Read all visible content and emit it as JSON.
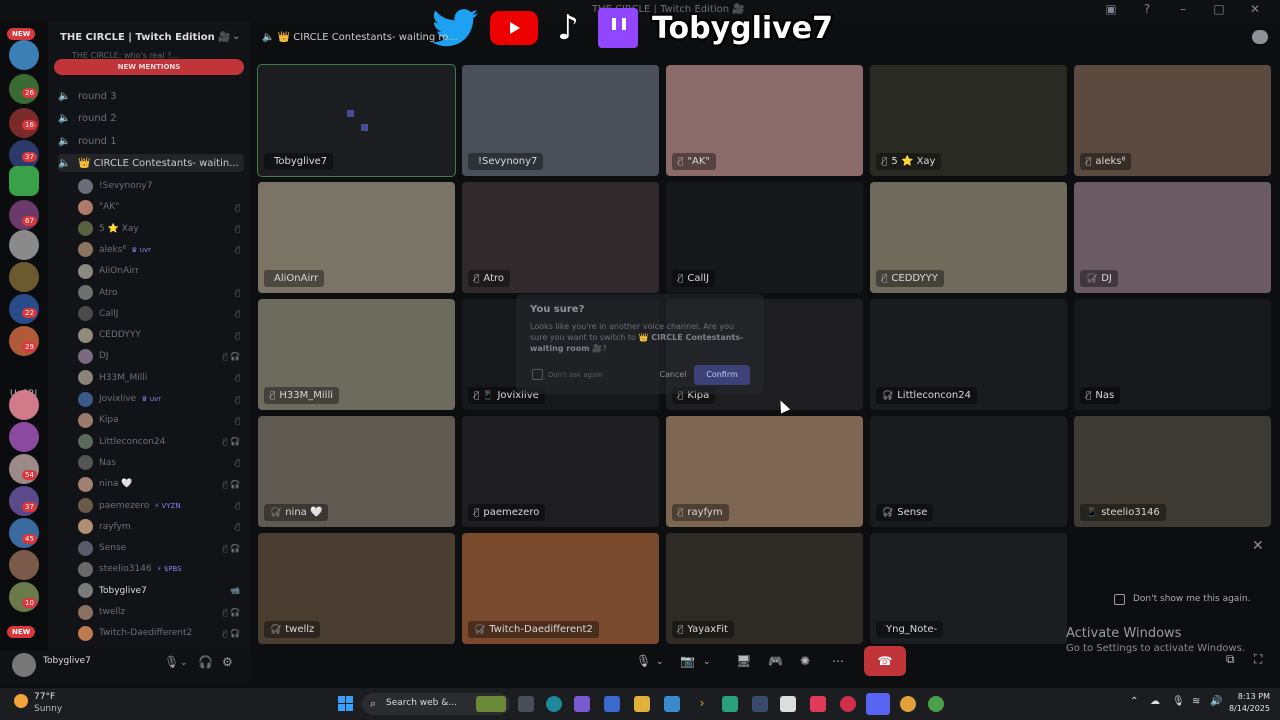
{
  "window": {
    "title": "THE CIRCLE | Twitch Edition 🎥"
  },
  "overlay": {
    "name": "Tobyglive7"
  },
  "rail": {
    "badges": [
      "26",
      "16",
      "37",
      "67",
      "22",
      "29",
      "54",
      "37",
      "45",
      "10"
    ],
    "new_label": "NEW",
    "folder_label": "UsGRI"
  },
  "sidebar": {
    "server_name": "THE CIRCLE | Twitch Edition 🎥",
    "cut_text": "THE CIRCLE: who's real ?...",
    "new_mentions": "NEW MENTIONS",
    "channels": [
      "round 3",
      "round 2",
      "round 1"
    ],
    "active_channel": "👑 CIRCLE Contestants- waitin...",
    "members": [
      {
        "name": "!Sevynony7",
        "tag": "",
        "icons": "",
        "color": "#6b6e78"
      },
      {
        "name": "\"AK\"",
        "tag": "",
        "icons": "🎙̸",
        "color": "#b07a6a"
      },
      {
        "name": "5 ⭐ Xay",
        "tag": "",
        "icons": "🎙̸",
        "color": "#5a6040"
      },
      {
        "name": "aleks⁸",
        "tag": "♛ uvr",
        "icons": "🎙̸",
        "color": "#8d7460"
      },
      {
        "name": "AliOnAirr",
        "tag": "",
        "icons": "",
        "color": "#8a8a80"
      },
      {
        "name": "Atro",
        "tag": "",
        "icons": "🎙̸",
        "color": "#707070"
      },
      {
        "name": "CallJ",
        "tag": "",
        "icons": "🎙̸",
        "color": "#4a4a4a"
      },
      {
        "name": "CEDDYYY",
        "tag": "",
        "icons": "🎙̸",
        "color": "#908a7a"
      },
      {
        "name": "DJ",
        "tag": "",
        "icons": "🎙̸ 🎧̸",
        "color": "#7a6a80"
      },
      {
        "name": "H33M_Milli",
        "tag": "",
        "icons": "🎙̸",
        "color": "#8a8578"
      },
      {
        "name": "Jovixlive",
        "tag": "♛ uvr",
        "icons": "🎙̸",
        "color": "#3a5a8a"
      },
      {
        "name": "Kipa",
        "tag": "",
        "icons": "🎙̸",
        "color": "#9a7a6a"
      },
      {
        "name": "Littleconcon24",
        "tag": "",
        "icons": "🎙̸ 🎧̸",
        "color": "#5a6a5a"
      },
      {
        "name": "Nas",
        "tag": "",
        "icons": "🎙̸",
        "color": "#555555"
      },
      {
        "name": "nina 🤍",
        "tag": "",
        "icons": "🎙̸ 🎧̸",
        "color": "#a08070"
      },
      {
        "name": "paemezero",
        "tag": "⚡ VYZN",
        "icons": "🎙̸",
        "color": "#6a5a4a"
      },
      {
        "name": "rayfym",
        "tag": "",
        "icons": "🎙̸",
        "color": "#b09070"
      },
      {
        "name": "Sense",
        "tag": "",
        "icons": "🎙̸ 🎧̸",
        "color": "#5a5a6a"
      },
      {
        "name": "steelio3146",
        "tag": "⚡ $PBS",
        "icons": "",
        "color": "#6a6a6a"
      },
      {
        "name": "Tobyglive7",
        "tag": "",
        "icons": "📹",
        "color": "#7a7a7a"
      },
      {
        "name": "twellz",
        "tag": "",
        "icons": "🎙̸ 🎧̸",
        "color": "#8a7060"
      },
      {
        "name": "Twitch-Daedifferent2",
        "tag": "",
        "icons": "🎙̸ 🎧̸",
        "color": "#c07a50"
      }
    ]
  },
  "user_panel": {
    "name": "Tobyglive7"
  },
  "call": {
    "header": "👑 CIRCLE Contestants- waiting ro...",
    "tiles": [
      {
        "label": "Tobyglive7",
        "mute": "",
        "bg": "#1c1d21"
      },
      {
        "label": "!Sevynony7",
        "mute": "",
        "bg": "#4b4f59"
      },
      {
        "label": "\"AK\"",
        "mute": "🎙̸",
        "bg": "#8a6b6a"
      },
      {
        "label": "5 ⭐ Xay",
        "mute": "🎙̸",
        "bg": "#2a2a24"
      },
      {
        "label": "aleks⁸",
        "mute": "🎙̸",
        "bg": "#5a4a40"
      },
      {
        "label": "AliOnAirr",
        "mute": "",
        "bg": "#7a7466"
      },
      {
        "label": "Atro",
        "mute": "🎙̸",
        "bg": "#302a2c"
      },
      {
        "label": "CallJ",
        "mute": "🎙̸",
        "bg": "#161719"
      },
      {
        "label": "CEDDYYY",
        "mute": "🎙̸",
        "bg": "#6e6a5c"
      },
      {
        "label": "DJ",
        "mute": "🎧̸",
        "bg": "#6a5a64"
      },
      {
        "label": "H33M_Milli",
        "mute": "🎙̸",
        "bg": "#6d6a5e"
      },
      {
        "label": "Jovixlive",
        "mute": "🎙̸ 📱",
        "bg": "#17181b"
      },
      {
        "label": "Kipa",
        "mute": "🎙̸",
        "bg": "#1e1e20"
      },
      {
        "label": "Littleconcon24",
        "mute": "🎧̸",
        "bg": "#1a1b1d"
      },
      {
        "label": "Nas",
        "mute": "🎙̸",
        "bg": "#17181a"
      },
      {
        "label": "nina 🤍",
        "mute": "🎧̸",
        "bg": "#5e5a52"
      },
      {
        "label": "paemezero",
        "mute": "🎙̸",
        "bg": "#1e1e20"
      },
      {
        "label": "rayfym",
        "mute": "🎙̸",
        "bg": "#7d6652"
      },
      {
        "label": "Sense",
        "mute": "🎧̸",
        "bg": "#1a1b1d"
      },
      {
        "label": "steelio3146",
        "mute": "📱",
        "bg": "#3c3a33"
      },
      {
        "label": "twellz",
        "mute": "🎧̸",
        "bg": "#4a3e32"
      },
      {
        "label": "Twitch-Daedifferent2",
        "mute": "🎧̸",
        "bg": "#7a4a2e"
      },
      {
        "label": "YayaxFit",
        "mute": "🎙̸",
        "bg": "#2e2a26"
      },
      {
        "label": "Yng_Note-",
        "mute": "",
        "bg": "#1c1d20"
      }
    ]
  },
  "dialog": {
    "title": "You sure?",
    "body_1": "Looks like you're in another voice channel. Are you sure you want to switch to ",
    "body_channel": "👑 CIRCLE Contestants- waiting room 🎥",
    "body_2": "?",
    "checkbox_label": "Don't ask again",
    "cancel": "Cancel",
    "confirm": "Confirm"
  },
  "notice": {
    "dont_show": "Don't show me this again."
  },
  "activate": {
    "line1": "Activate Windows",
    "line2": "Go to Settings to activate Windows."
  },
  "taskbar": {
    "temp": "77°F",
    "condition": "Sunny",
    "search": "Search web &...",
    "time": "8:13 PM",
    "date": "8/14/2025"
  }
}
